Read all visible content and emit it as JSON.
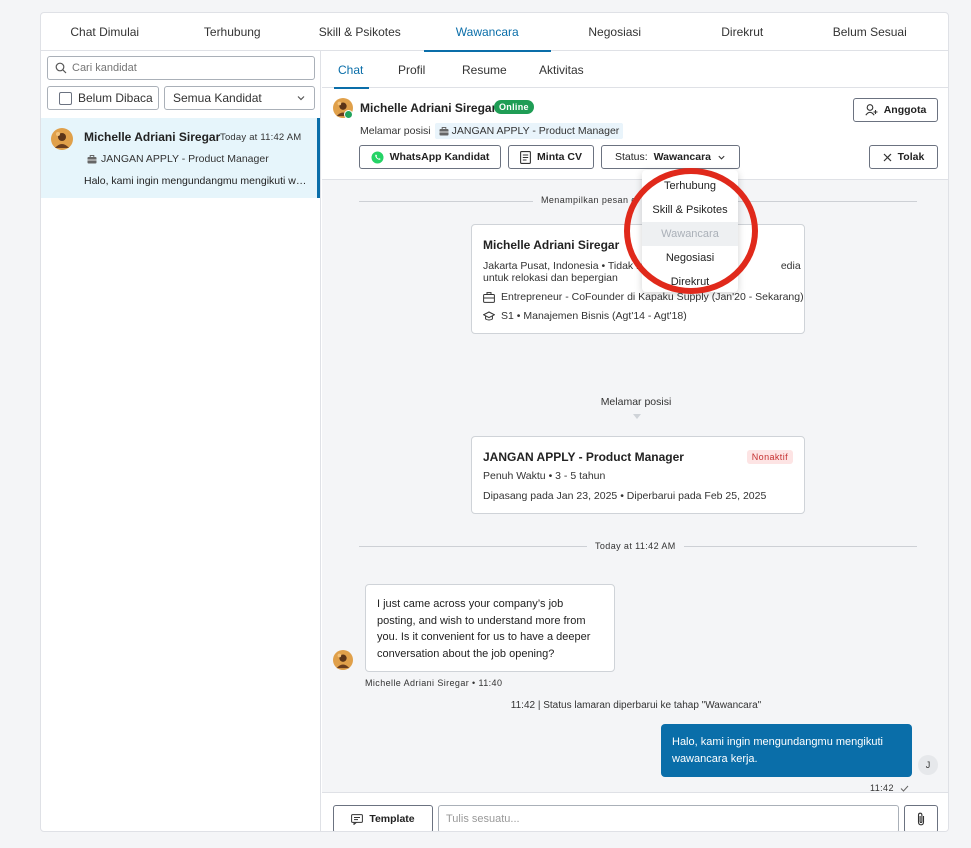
{
  "top_tabs": [
    {
      "label": "Chat Dimulai"
    },
    {
      "label": "Terhubung"
    },
    {
      "label": "Skill & Psikotes"
    },
    {
      "label": "Wawancara",
      "active": true
    },
    {
      "label": "Negosiasi"
    },
    {
      "label": "Direkrut"
    },
    {
      "label": "Belum Sesuai"
    }
  ],
  "sidebar": {
    "search_placeholder": "Cari kandidat",
    "filter_unread_label": "Belum Dibaca",
    "filter_all_label": "Semua Kandidat",
    "candidate": {
      "name": "Michelle Adriani Siregar",
      "time": "Today at 11:42 AM",
      "job": "JANGAN APPLY - Product Manager",
      "preview": "Halo, kami ingin mengundangmu mengikuti wawancara kerja."
    }
  },
  "sub_tabs": [
    {
      "label": "Chat",
      "active": true
    },
    {
      "label": "Profil"
    },
    {
      "label": "Resume"
    },
    {
      "label": "Aktivitas"
    }
  ],
  "header": {
    "name": "Michelle Adriani Siregar",
    "online_label": "Online",
    "applying_label": "Melamar posisi",
    "job": "JANGAN APPLY - Product Manager",
    "anggota_label": "Anggota",
    "whatsapp_label": "WhatsApp Kandidat",
    "cv_label": "Minta CV",
    "status_prefix": "Status:",
    "status_value": "Wawancara",
    "reject_label": "Tolak"
  },
  "status_dropdown": {
    "options": [
      "Terhubung",
      "Skill & Psikotes",
      "Wawancara",
      "Negosiasi",
      "Direkrut"
    ],
    "selected": "Wawancara"
  },
  "chat": {
    "top_divider_label": "Menampilkan pesan d",
    "profile_card": {
      "name": "Michelle Adriani Siregar",
      "location_line": "Jakarta Pusat, Indonesia • Tidak m",
      "location_line_tail": "edia",
      "relocation_line": "untuk relokasi dan bepergian",
      "work": "Entrepreneur - CoFounder di Kapaku Supply (Jan'20 - Sekarang)",
      "education": "S1 • Manajemen Bisnis (Agt'14 - Agt'18)"
    },
    "applying_label": "Melamar posisi",
    "job_card": {
      "title": "JANGAN APPLY - Product Manager",
      "status_badge": "Nonaktif",
      "type": "Penuh Waktu • 3 - 5 tahun",
      "dates": "Dipasang pada Jan 23, 2025 • Diperbarui pada Feb 25, 2025"
    },
    "time_divider_label": "Today at 11:42 AM",
    "incoming": {
      "lines": [
        "I just came across your company’s job",
        "posting, and wish to understand more from",
        "you. Is it convenient for us to have a deeper",
        "conversation about the job opening?"
      ],
      "sender_meta": "Michelle Adriani Siregar • 11:40"
    },
    "system_message": "11:42 | Status lamaran diperbarui ke tahap \"Wawancara\"",
    "outgoing": {
      "lines": [
        "Halo, kami ingin mengundangmu mengikuti",
        "wawancara kerja."
      ],
      "time": "11:42",
      "avatar_initial": "J"
    }
  },
  "composer": {
    "template_label": "Template",
    "input_placeholder": "Tulis sesuatu..."
  },
  "colors": {
    "accent": "#0a6ea9",
    "online": "#1f9d55",
    "whatsapp": "#25d366",
    "highlight_ring": "#e0291b"
  }
}
